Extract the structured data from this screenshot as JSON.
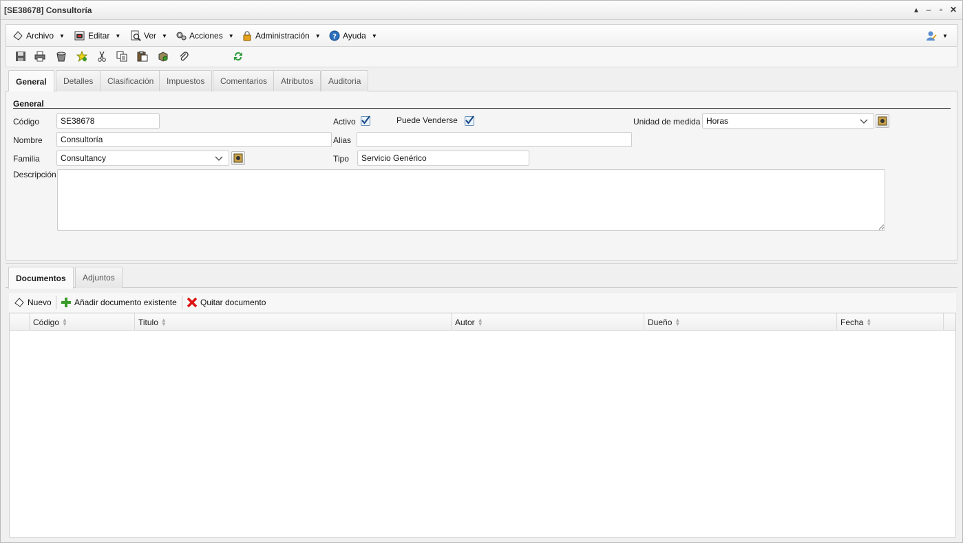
{
  "window": {
    "title": "[SE38678] Consultoría"
  },
  "menu": [
    {
      "label": "Archivo",
      "icon": "file-icon"
    },
    {
      "label": "Editar",
      "icon": "edit-icon"
    },
    {
      "label": "Ver",
      "icon": "view-icon"
    },
    {
      "label": "Acciones",
      "icon": "actions-icon"
    },
    {
      "label": "Administración",
      "icon": "lock-icon"
    },
    {
      "label": "Ayuda",
      "icon": "help-icon"
    }
  ],
  "toolbar_icons": [
    "save-icon",
    "print-icon",
    "delete-icon",
    "favorite-icon",
    "cut-icon",
    "copy-icon",
    "paste-icon",
    "duplicate-icon",
    "attach-icon",
    "refresh-icon"
  ],
  "tabs": [
    {
      "label": "General"
    },
    {
      "label": "Detalles"
    },
    {
      "label": "Clasificación"
    },
    {
      "label": "Impuestos"
    },
    {
      "label": "Comentarios"
    },
    {
      "label": "Atributos"
    },
    {
      "label": "Auditoria"
    }
  ],
  "form": {
    "section": "General",
    "codigo": {
      "label": "Código",
      "value": "SE38678"
    },
    "nombre": {
      "label": "Nombre",
      "value": "Consultoría"
    },
    "familia": {
      "label": "Familia",
      "value": "Consultancy"
    },
    "descripcion": {
      "label": "Descripción",
      "value": ""
    },
    "activo": {
      "label": "Activo",
      "checked": true
    },
    "puede_venderse": {
      "label": "Puede Venderse",
      "checked": true
    },
    "alias": {
      "label": "Alias",
      "value": ""
    },
    "tipo": {
      "label": "Tipo",
      "value": "Servicio Genérico"
    },
    "unidad": {
      "label": "Unidad de medida",
      "value": "Horas"
    }
  },
  "doc_tabs": [
    {
      "label": "Documentos"
    },
    {
      "label": "Adjuntos"
    }
  ],
  "doc_toolbar": {
    "new": "Nuevo",
    "add_existing": "Añadir documento existente",
    "remove": "Quitar documento"
  },
  "grid_columns": [
    "Código",
    "Titulo",
    "Autor",
    "Dueño",
    "Fecha"
  ],
  "colors": {
    "accent": "#1a5fa8",
    "remove": "#d11",
    "add": "#3a9a2a"
  }
}
